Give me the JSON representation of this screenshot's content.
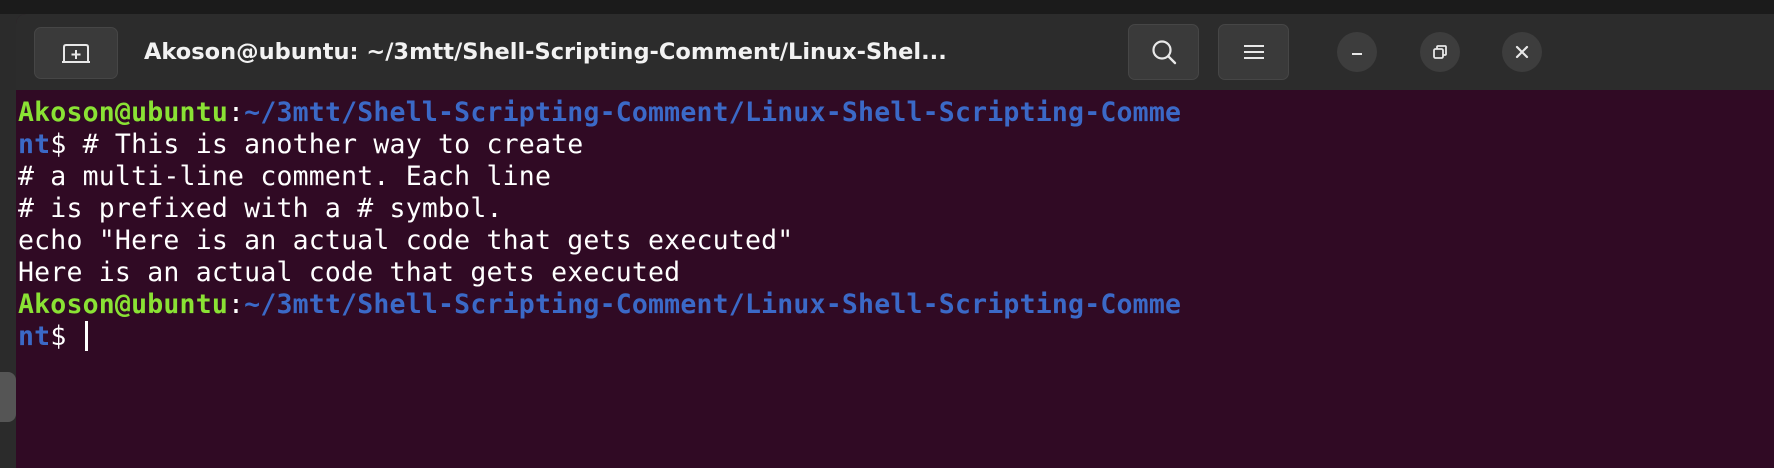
{
  "window": {
    "title": "Akoson@ubuntu: ~/3mtt/Shell-Scripting-Comment/Linux-Shel...",
    "new_tab_icon": "new-tab-icon",
    "search_icon": "search-icon",
    "menu_icon": "hamburger-menu-icon",
    "minimize_icon": "minimize-icon",
    "maximize_icon": "restore-icon",
    "close_icon": "close-icon"
  },
  "colors": {
    "background": "#300a24",
    "titlebar": "#2c2c2c",
    "prompt_user": "#8ae234",
    "prompt_path": "#3b69c7",
    "text": "#ffffff"
  },
  "terminal": {
    "prompt1": {
      "user_host": "Akoson@ubuntu",
      "colon": ":",
      "path_part1": "~/3mtt/Shell-Scripting-Comment/Linux-Shell-Scripting-Comme",
      "path_part2": "nt",
      "dollar": "$ ",
      "command": "# This is another way to create"
    },
    "lines": [
      "# a multi-line comment. Each line",
      "# is prefixed with a # symbol.",
      "echo \"Here is an actual code that gets executed\"",
      "Here is an actual code that gets executed"
    ],
    "prompt2": {
      "user_host": "Akoson@ubuntu",
      "colon": ":",
      "path_part1": "~/3mtt/Shell-Scripting-Comment/Linux-Shell-Scripting-Comme",
      "path_part2": "nt",
      "dollar": "$ "
    }
  }
}
